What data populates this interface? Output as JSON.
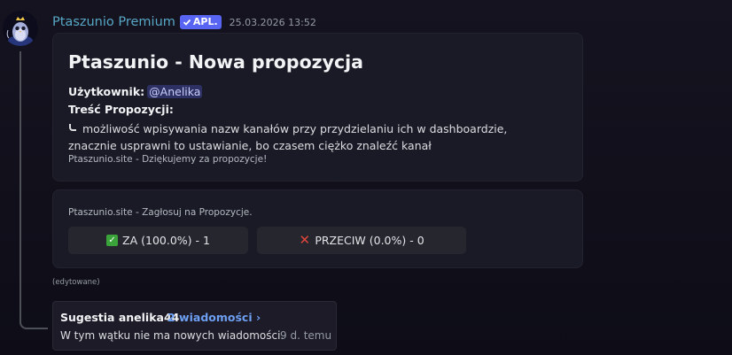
{
  "message": {
    "author": "Ptaszunio Premium",
    "badge": "APL.",
    "timestamp": "25.03.2026 13:52",
    "edited_label": "(edytowane)"
  },
  "embed": {
    "title": "Ptaszunio - Nowa propozycja",
    "user_label": "Użytkownik:",
    "user_mention": "@Anelika",
    "content_label": "Treść Propozycji:",
    "content_text": "możliwość wpisywania nazw kanałów przy przydzielaniu ich w dashboardzie, znacznie usprawni to ustawianie, bo czasem ciężko znaleźć kanał",
    "footer": "Ptaszunio.site - Dziękujemy za propozycje!"
  },
  "vote": {
    "label": "Ptaszunio.site - Zagłosuj na Propozycje.",
    "yes_label": "ZA (100.0%) - 1",
    "no_label": "PRZECIW (0.0%) - 0",
    "yes_icon": "check-mark-icon",
    "no_icon": "cross-mark-icon",
    "yes_color": "#3aa33a",
    "no_color": "#e0453a"
  },
  "thread": {
    "name": "Sugestia anelika44",
    "link": "2 wiadomości ›",
    "status": "W tym wątku nie ma nowych wiadomości.",
    "time": "9 d. temu"
  },
  "colors": {
    "author": "#57a7c6",
    "badge": "#5865f2",
    "link": "#6d9ff2"
  }
}
